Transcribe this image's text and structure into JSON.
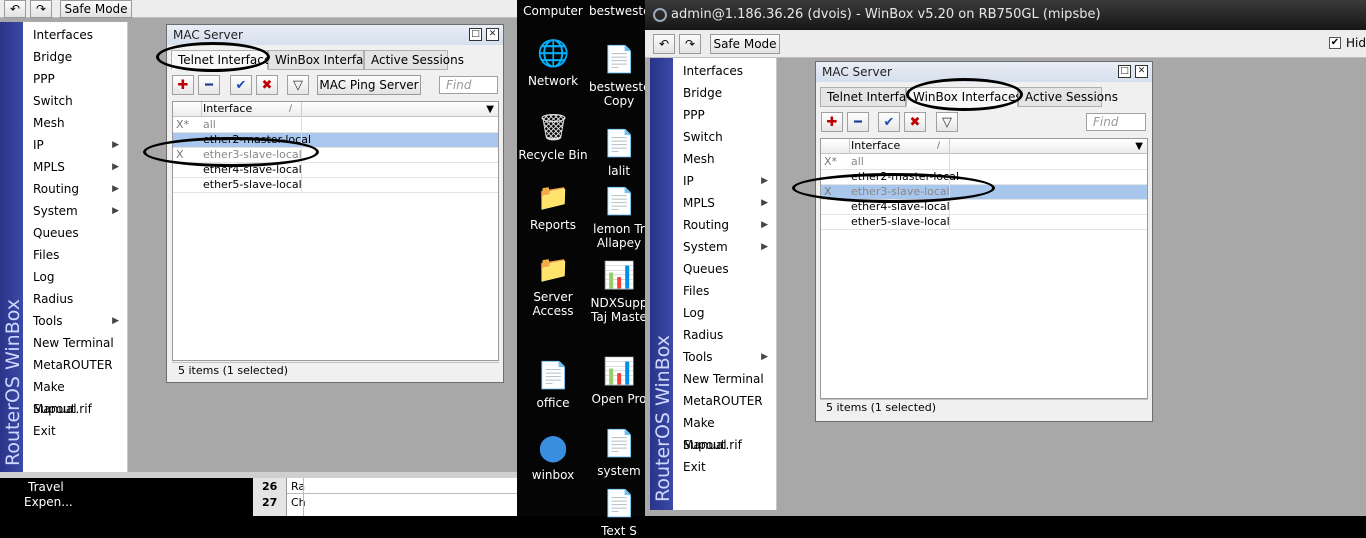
{
  "left": {
    "toolbar": {
      "undo": "↶",
      "redo": "↷",
      "safe_mode": "Safe Mode"
    },
    "brand": "RouterOS WinBox",
    "menu": [
      {
        "label": "Interfaces",
        "arrow": false
      },
      {
        "label": "Bridge",
        "arrow": false
      },
      {
        "label": "PPP",
        "arrow": false
      },
      {
        "label": "Switch",
        "arrow": false
      },
      {
        "label": "Mesh",
        "arrow": false
      },
      {
        "label": "IP",
        "arrow": true
      },
      {
        "label": "MPLS",
        "arrow": true
      },
      {
        "label": "Routing",
        "arrow": true
      },
      {
        "label": "System",
        "arrow": true
      },
      {
        "label": "Queues",
        "arrow": false
      },
      {
        "label": "Files",
        "arrow": false
      },
      {
        "label": "Log",
        "arrow": false
      },
      {
        "label": "Radius",
        "arrow": false
      },
      {
        "label": "Tools",
        "arrow": true
      },
      {
        "label": "New Terminal",
        "arrow": false
      },
      {
        "label": "MetaROUTER",
        "arrow": false
      },
      {
        "label": "Make Supout.rif",
        "arrow": false
      },
      {
        "label": "Manual",
        "arrow": false
      },
      {
        "label": "Exit",
        "arrow": false
      }
    ],
    "mac_server": {
      "title": "MAC Server",
      "tabs": [
        "Telnet Interfaces",
        "WinBox Interfaces",
        "Active Sessions"
      ],
      "active_tab": 0,
      "ping_button": "MAC Ping Server",
      "find_placeholder": "Find",
      "col_header": "Interface",
      "rows": [
        {
          "flag": "X*",
          "name": "all",
          "selected": false,
          "disabled": true
        },
        {
          "flag": "",
          "name": "ether2-master-local",
          "selected": true,
          "disabled": false
        },
        {
          "flag": "X",
          "name": "ether3-slave-local",
          "selected": false,
          "disabled": true
        },
        {
          "flag": "",
          "name": "ether4-slave-local",
          "selected": false,
          "disabled": false
        },
        {
          "flag": "",
          "name": "ether5-slave-local",
          "selected": false,
          "disabled": false
        }
      ],
      "status": "5 items (1 selected)"
    }
  },
  "desktop": {
    "icons": [
      {
        "label": "Computer"
      },
      {
        "label": "bestweste"
      },
      {
        "label": "Network"
      },
      {
        "label": "bestweste Copy"
      },
      {
        "label": "Recycle Bin"
      },
      {
        "label": "lalit"
      },
      {
        "label": "Reports"
      },
      {
        "label": "lemon Tr Allapey"
      },
      {
        "label": "Server Access"
      },
      {
        "label": "NDXSupp Taj Maste"
      },
      {
        "label": "office"
      },
      {
        "label": "Open Pro"
      },
      {
        "label": "winbox"
      },
      {
        "label": "system"
      },
      {
        "label": "Text S"
      }
    ]
  },
  "spreadsheet": {
    "rows": [
      {
        "label": "Travel",
        "num": "26",
        "cell": "Ra"
      },
      {
        "label": "Expen...",
        "num": "27",
        "cell": "Ch"
      }
    ]
  },
  "right": {
    "title": "admin@1.186.36.26 (dvois) - WinBox v5.20 on RB750GL (mipsbe)",
    "toolbar": {
      "undo": "↶",
      "redo": "↷",
      "safe_mode": "Safe Mode",
      "hide_label": "Hide"
    },
    "brand": "RouterOS WinBox",
    "mac_server": {
      "title": "MAC Server",
      "tabs": [
        "Telnet Interfaces",
        "WinBox Interfaces",
        "Active Sessions"
      ],
      "active_tab": 1,
      "find_placeholder": "Find",
      "col_header": "Interface",
      "rows": [
        {
          "flag": "X*",
          "name": "all",
          "selected": false,
          "disabled": true
        },
        {
          "flag": "",
          "name": "ether2-master-local",
          "selected": false,
          "disabled": false
        },
        {
          "flag": "X",
          "name": "ether3-slave-local",
          "selected": true,
          "disabled": true
        },
        {
          "flag": "",
          "name": "ether4-slave-local",
          "selected": false,
          "disabled": false
        },
        {
          "flag": "",
          "name": "ether5-slave-local",
          "selected": false,
          "disabled": false
        }
      ],
      "status": "5 items (1 selected)"
    }
  },
  "colors": {
    "brand_blue": "#2a3488",
    "selection": "#a9c6ec",
    "add_red": "#c00000",
    "ok_blue": "#1b4fb8"
  }
}
